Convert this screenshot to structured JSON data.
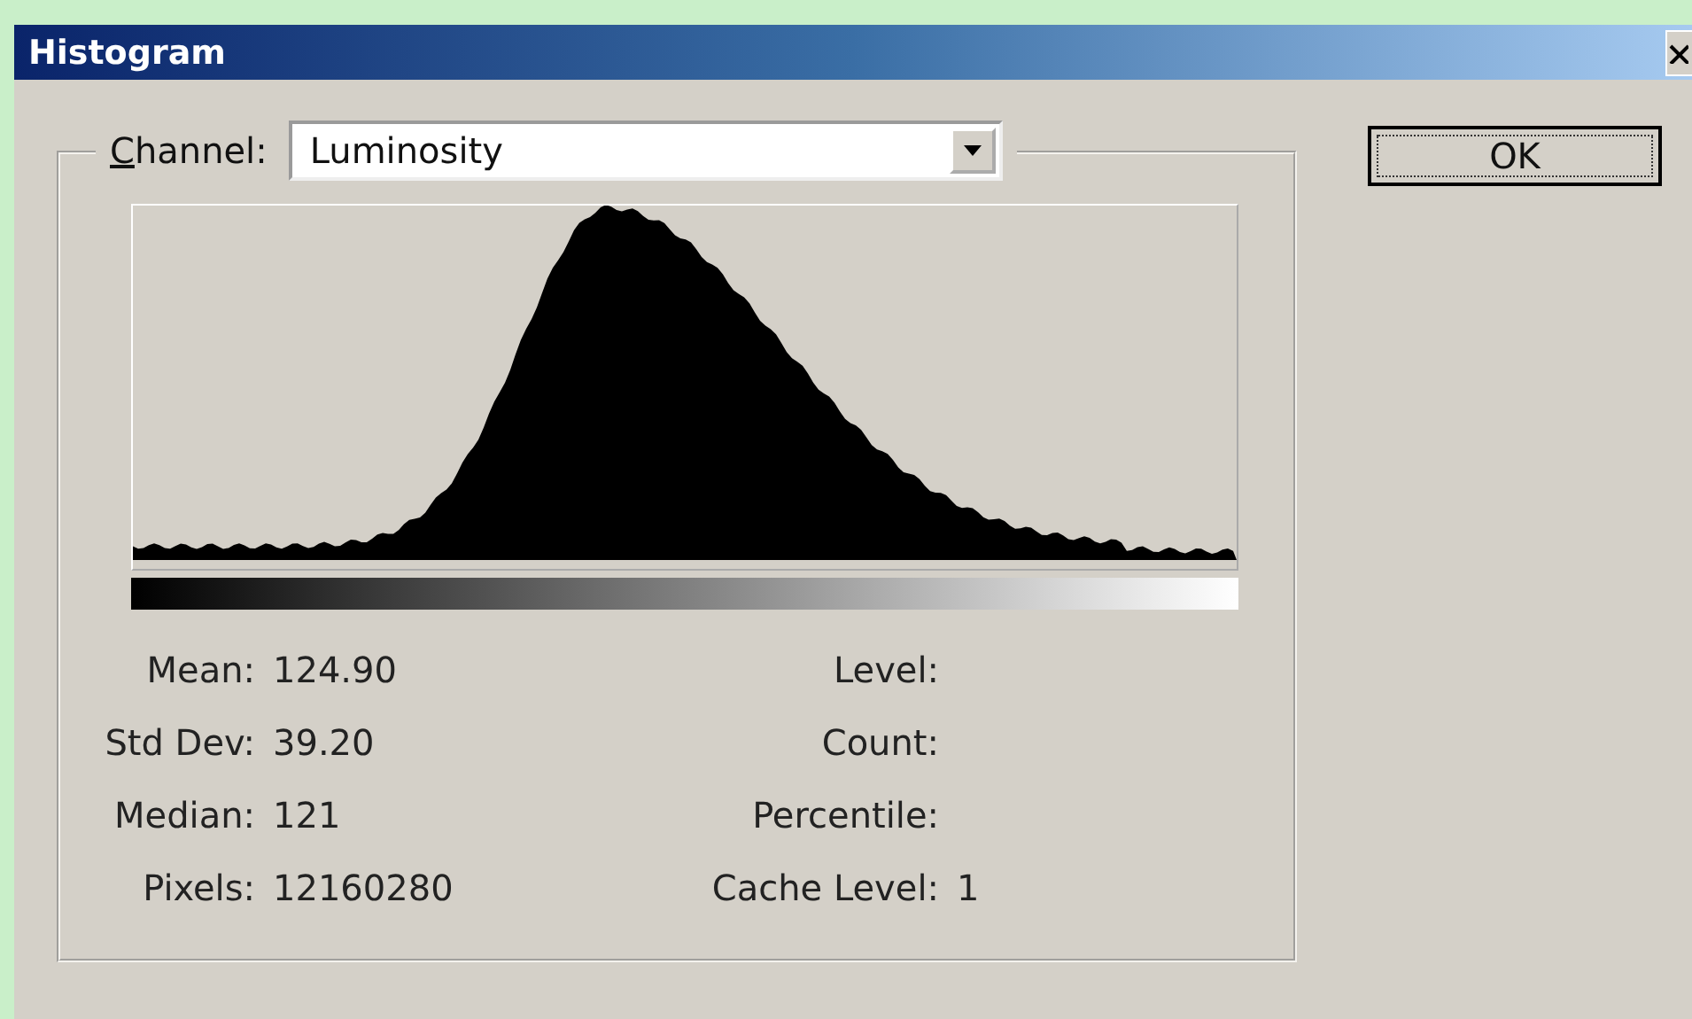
{
  "window": {
    "title": "Histogram"
  },
  "channel": {
    "label": "Channel:",
    "value": "Luminosity"
  },
  "ok_button": "OK",
  "stats_left": [
    {
      "label": "Mean:",
      "value": "124.90"
    },
    {
      "label": "Std Dev:",
      "value": "39.20"
    },
    {
      "label": "Median:",
      "value": "121"
    },
    {
      "label": "Pixels:",
      "value": "12160280"
    }
  ],
  "stats_right": [
    {
      "label": "Level:"
    },
    {
      "label": "Count:"
    },
    {
      "label": "Percentile:"
    },
    {
      "label": "Cache Level:",
      "value": "1"
    }
  ]
}
